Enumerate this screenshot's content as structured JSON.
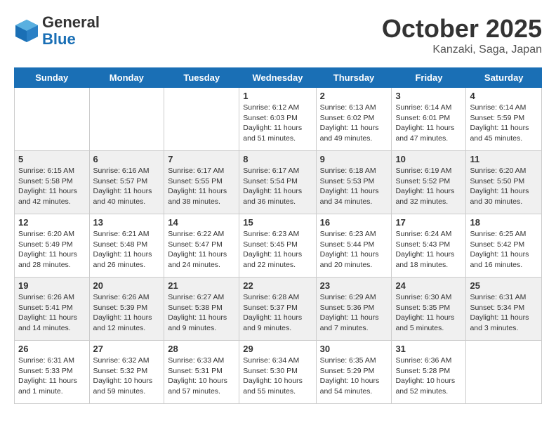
{
  "header": {
    "logo_general": "General",
    "logo_blue": "Blue",
    "month": "October 2025",
    "location": "Kanzaki, Saga, Japan"
  },
  "days_of_week": [
    "Sunday",
    "Monday",
    "Tuesday",
    "Wednesday",
    "Thursday",
    "Friday",
    "Saturday"
  ],
  "weeks": [
    [
      {
        "day": "",
        "sunrise": "",
        "sunset": "",
        "daylight": ""
      },
      {
        "day": "",
        "sunrise": "",
        "sunset": "",
        "daylight": ""
      },
      {
        "day": "",
        "sunrise": "",
        "sunset": "",
        "daylight": ""
      },
      {
        "day": "1",
        "sunrise": "Sunrise: 6:12 AM",
        "sunset": "Sunset: 6:03 PM",
        "daylight": "Daylight: 11 hours and 51 minutes."
      },
      {
        "day": "2",
        "sunrise": "Sunrise: 6:13 AM",
        "sunset": "Sunset: 6:02 PM",
        "daylight": "Daylight: 11 hours and 49 minutes."
      },
      {
        "day": "3",
        "sunrise": "Sunrise: 6:14 AM",
        "sunset": "Sunset: 6:01 PM",
        "daylight": "Daylight: 11 hours and 47 minutes."
      },
      {
        "day": "4",
        "sunrise": "Sunrise: 6:14 AM",
        "sunset": "Sunset: 5:59 PM",
        "daylight": "Daylight: 11 hours and 45 minutes."
      }
    ],
    [
      {
        "day": "5",
        "sunrise": "Sunrise: 6:15 AM",
        "sunset": "Sunset: 5:58 PM",
        "daylight": "Daylight: 11 hours and 42 minutes."
      },
      {
        "day": "6",
        "sunrise": "Sunrise: 6:16 AM",
        "sunset": "Sunset: 5:57 PM",
        "daylight": "Daylight: 11 hours and 40 minutes."
      },
      {
        "day": "7",
        "sunrise": "Sunrise: 6:17 AM",
        "sunset": "Sunset: 5:55 PM",
        "daylight": "Daylight: 11 hours and 38 minutes."
      },
      {
        "day": "8",
        "sunrise": "Sunrise: 6:17 AM",
        "sunset": "Sunset: 5:54 PM",
        "daylight": "Daylight: 11 hours and 36 minutes."
      },
      {
        "day": "9",
        "sunrise": "Sunrise: 6:18 AM",
        "sunset": "Sunset: 5:53 PM",
        "daylight": "Daylight: 11 hours and 34 minutes."
      },
      {
        "day": "10",
        "sunrise": "Sunrise: 6:19 AM",
        "sunset": "Sunset: 5:52 PM",
        "daylight": "Daylight: 11 hours and 32 minutes."
      },
      {
        "day": "11",
        "sunrise": "Sunrise: 6:20 AM",
        "sunset": "Sunset: 5:50 PM",
        "daylight": "Daylight: 11 hours and 30 minutes."
      }
    ],
    [
      {
        "day": "12",
        "sunrise": "Sunrise: 6:20 AM",
        "sunset": "Sunset: 5:49 PM",
        "daylight": "Daylight: 11 hours and 28 minutes."
      },
      {
        "day": "13",
        "sunrise": "Sunrise: 6:21 AM",
        "sunset": "Sunset: 5:48 PM",
        "daylight": "Daylight: 11 hours and 26 minutes."
      },
      {
        "day": "14",
        "sunrise": "Sunrise: 6:22 AM",
        "sunset": "Sunset: 5:47 PM",
        "daylight": "Daylight: 11 hours and 24 minutes."
      },
      {
        "day": "15",
        "sunrise": "Sunrise: 6:23 AM",
        "sunset": "Sunset: 5:45 PM",
        "daylight": "Daylight: 11 hours and 22 minutes."
      },
      {
        "day": "16",
        "sunrise": "Sunrise: 6:23 AM",
        "sunset": "Sunset: 5:44 PM",
        "daylight": "Daylight: 11 hours and 20 minutes."
      },
      {
        "day": "17",
        "sunrise": "Sunrise: 6:24 AM",
        "sunset": "Sunset: 5:43 PM",
        "daylight": "Daylight: 11 hours and 18 minutes."
      },
      {
        "day": "18",
        "sunrise": "Sunrise: 6:25 AM",
        "sunset": "Sunset: 5:42 PM",
        "daylight": "Daylight: 11 hours and 16 minutes."
      }
    ],
    [
      {
        "day": "19",
        "sunrise": "Sunrise: 6:26 AM",
        "sunset": "Sunset: 5:41 PM",
        "daylight": "Daylight: 11 hours and 14 minutes."
      },
      {
        "day": "20",
        "sunrise": "Sunrise: 6:26 AM",
        "sunset": "Sunset: 5:39 PM",
        "daylight": "Daylight: 11 hours and 12 minutes."
      },
      {
        "day": "21",
        "sunrise": "Sunrise: 6:27 AM",
        "sunset": "Sunset: 5:38 PM",
        "daylight": "Daylight: 11 hours and 9 minutes."
      },
      {
        "day": "22",
        "sunrise": "Sunrise: 6:28 AM",
        "sunset": "Sunset: 5:37 PM",
        "daylight": "Daylight: 11 hours and 9 minutes."
      },
      {
        "day": "23",
        "sunrise": "Sunrise: 6:29 AM",
        "sunset": "Sunset: 5:36 PM",
        "daylight": "Daylight: 11 hours and 7 minutes."
      },
      {
        "day": "24",
        "sunrise": "Sunrise: 6:30 AM",
        "sunset": "Sunset: 5:35 PM",
        "daylight": "Daylight: 11 hours and 5 minutes."
      },
      {
        "day": "25",
        "sunrise": "Sunrise: 6:31 AM",
        "sunset": "Sunset: 5:34 PM",
        "daylight": "Daylight: 11 hours and 3 minutes."
      }
    ],
    [
      {
        "day": "26",
        "sunrise": "Sunrise: 6:31 AM",
        "sunset": "Sunset: 5:33 PM",
        "daylight": "Daylight: 11 hours and 1 minute."
      },
      {
        "day": "27",
        "sunrise": "Sunrise: 6:32 AM",
        "sunset": "Sunset: 5:32 PM",
        "daylight": "Daylight: 10 hours and 59 minutes."
      },
      {
        "day": "28",
        "sunrise": "Sunrise: 6:33 AM",
        "sunset": "Sunset: 5:31 PM",
        "daylight": "Daylight: 10 hours and 57 minutes."
      },
      {
        "day": "29",
        "sunrise": "Sunrise: 6:34 AM",
        "sunset": "Sunset: 5:30 PM",
        "daylight": "Daylight: 10 hours and 55 minutes."
      },
      {
        "day": "30",
        "sunrise": "Sunrise: 6:35 AM",
        "sunset": "Sunset: 5:29 PM",
        "daylight": "Daylight: 10 hours and 54 minutes."
      },
      {
        "day": "31",
        "sunrise": "Sunrise: 6:36 AM",
        "sunset": "Sunset: 5:28 PM",
        "daylight": "Daylight: 10 hours and 52 minutes."
      },
      {
        "day": "",
        "sunrise": "",
        "sunset": "",
        "daylight": ""
      }
    ]
  ]
}
